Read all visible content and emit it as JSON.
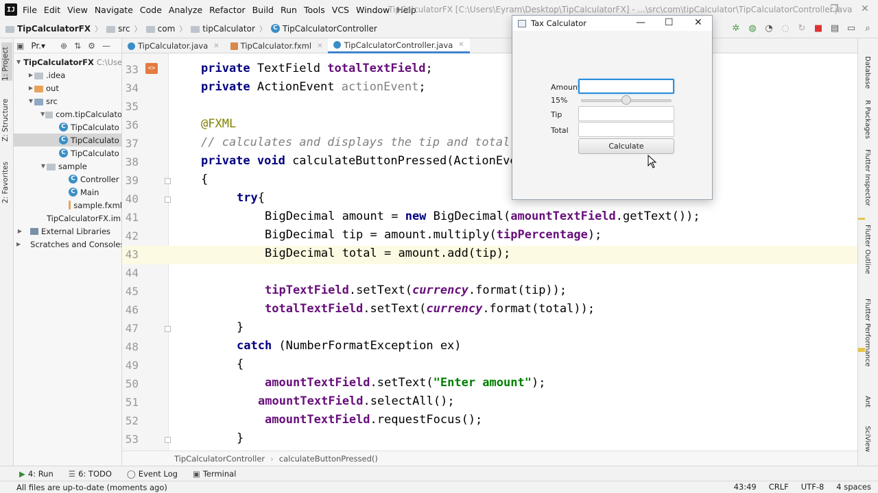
{
  "menubar": {
    "logo": "IJ",
    "items": [
      "File",
      "Edit",
      "View",
      "Navigate",
      "Code",
      "Analyze",
      "Refactor",
      "Build",
      "Run",
      "Tools",
      "VCS",
      "Window",
      "Help"
    ],
    "title": "TipCalculatorFX [C:\\Users\\Eyram\\Desktop\\TipCalculatorFX] - ...\\src\\com\\tipCalculator\\TipCalculatorController.java"
  },
  "navbar": {
    "crumbs": [
      "TipCalculatorFX",
      "src",
      "com",
      "tipCalculator",
      "TipCalculatorController"
    ]
  },
  "left_strip": {
    "project": "1: Project",
    "structure": "Z: Structure",
    "favorites": "2: Favorites"
  },
  "project": {
    "header": "Pr.▾",
    "tree": [
      {
        "label": "TipCalculatorFX",
        "suffix": "C:\\Use"
      },
      {
        "label": ".idea"
      },
      {
        "label": "out"
      },
      {
        "label": "src"
      },
      {
        "label": "com.tipCalculato"
      },
      {
        "label": "TipCalculato"
      },
      {
        "label": "TipCalculato"
      },
      {
        "label": "TipCalculato"
      },
      {
        "label": "sample"
      },
      {
        "label": "Controller"
      },
      {
        "label": "Main"
      },
      {
        "label": "sample.fxml"
      },
      {
        "label": "TipCalculatorFX.iml"
      },
      {
        "label": "External Libraries"
      },
      {
        "label": "Scratches and Consoles"
      }
    ]
  },
  "tabs": [
    {
      "label": "TipCalculator.java"
    },
    {
      "label": "TipCalculator.fxml"
    },
    {
      "label": "TipCalculatorController.java"
    }
  ],
  "editor": {
    "line_numbers": [
      "33",
      "34",
      "35",
      "36",
      "37",
      "38",
      "39",
      "40",
      "41",
      "42",
      "43",
      "44",
      "45",
      "46",
      "47",
      "48",
      "49",
      "50",
      "51",
      "52",
      "53"
    ],
    "current_line": "43"
  },
  "editor_crumb": {
    "class": "TipCalculatorController",
    "method": "calculateButtonPressed()"
  },
  "right_strip": [
    "Database",
    "R Packages",
    "Flutter Inspector",
    "Flutter Outline",
    "Flutter Performance",
    "Ant",
    "SciView"
  ],
  "bottom_tools": {
    "run": "4: Run",
    "todo": "6: TODO",
    "event_log": "Event Log",
    "terminal": "Terminal"
  },
  "status": {
    "message": "All files are up-to-date (moments ago)",
    "position": "43:49",
    "line_sep": "CRLF",
    "encoding": "UTF-8",
    "indent": "4 spaces"
  },
  "dialog": {
    "title": "Tax Calculator",
    "amount_label": "Amount",
    "percent_label": "15%",
    "tip_label": "Tip",
    "total_label": "Total",
    "calculate": "Calculate",
    "slider_value": 0.5
  }
}
